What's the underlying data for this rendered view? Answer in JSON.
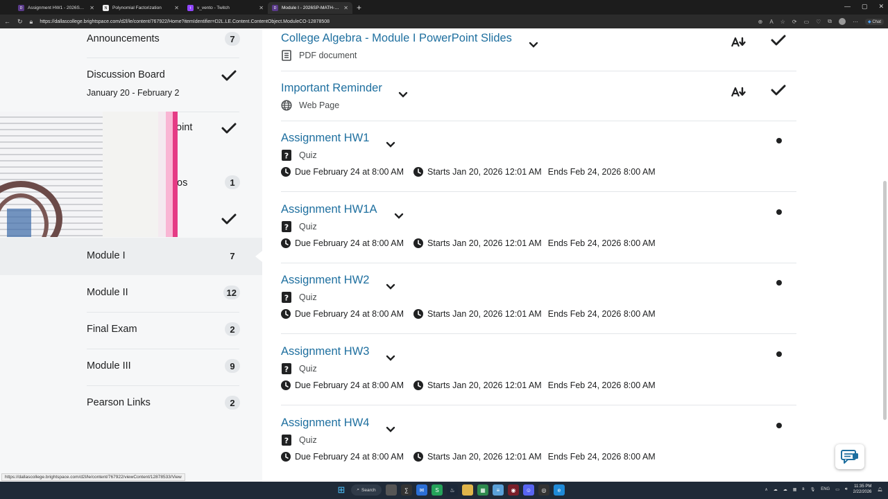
{
  "browser": {
    "tabs": [
      {
        "label": "Assignment HW1 - 2026SP-MATH-",
        "icon": "d2l-favicon",
        "color": "#5a3a8a",
        "active": false
      },
      {
        "label": "Polynomial Factorization",
        "icon": "notion-favicon",
        "color": "#444444",
        "active": false
      },
      {
        "label": "v_vento - Twitch",
        "icon": "twitch-favicon",
        "color": "#9146ff",
        "active": false
      },
      {
        "label": "Module I - 2026SP-MATH-1314-",
        "icon": "d2l-favicon",
        "color": "#5a3a8a",
        "active": true
      }
    ],
    "url": "https://dallascollege.brightspace.com/d2l/le/content/767922/Home?itemIdentifier=D2L.LE.Content.ContentObject.ModuleCO-12878508",
    "chat_label": "Chat",
    "status_url": "https://dallascollege.brightspace.com/d2l/le/content/767922/viewContent/12878533/View"
  },
  "sidebar": {
    "items": [
      {
        "label": "Announcements",
        "count": "7"
      },
      {
        "label": "Discussion Board",
        "sub": "January 20 - February 2",
        "done": true
      },
      {
        "label": "oint",
        "done": true
      },
      {
        "label": "os",
        "count": "1"
      },
      {
        "label": "",
        "done": true
      },
      {
        "label": "Module I",
        "count": "7",
        "active": true
      },
      {
        "label": "Module II",
        "count": "12"
      },
      {
        "label": "Final Exam",
        "count": "2"
      },
      {
        "label": "Module III",
        "count": "9"
      },
      {
        "label": "Pearson Links",
        "count": "2"
      }
    ]
  },
  "content": {
    "items": [
      {
        "title": "College Algebra - Module I PowerPoint Slides",
        "type": "PDF document",
        "type_icon": "document-icon"
      },
      {
        "title": "Important Reminder",
        "type": "Web Page",
        "type_icon": "globe-icon"
      },
      {
        "title": "Assignment HW1",
        "type": "Quiz",
        "due": "Due February 24 at 8:00 AM",
        "starts": "Starts Jan 20, 2026 12:01 AM",
        "ends": "Ends Feb 24, 2026 8:00 AM"
      },
      {
        "title": "Assignment HW1A",
        "type": "Quiz",
        "due": "Due February 24 at 8:00 AM",
        "starts": "Starts Jan 20, 2026 12:01 AM",
        "ends": "Ends Feb 24, 2026 8:00 AM"
      },
      {
        "title": "Assignment HW2",
        "type": "Quiz",
        "due": "Due February 24 at 8:00 AM",
        "starts": "Starts Jan 20, 2026 12:01 AM",
        "ends": "Ends Feb 24, 2026 8:00 AM"
      },
      {
        "title": "Assignment HW3",
        "type": "Quiz",
        "due": "Due February 24 at 8:00 AM",
        "starts": "Starts Jan 20, 2026 12:01 AM",
        "ends": "Ends Feb 24, 2026 8:00 AM"
      },
      {
        "title": "Assignment HW4",
        "type": "Quiz",
        "due": "Due February 24 at 8:00 AM",
        "starts": "Starts Jan 20, 2026 12:01 AM",
        "ends": "Ends Feb 24, 2026 8:00 AM"
      }
    ]
  },
  "taskbar": {
    "search_label": "Search",
    "lang": "ENG",
    "time": "11:35 PM",
    "date": "2/22/2026"
  },
  "colors": {
    "link": "#1e6f9f",
    "sidebar_bg": "#f6f7f8",
    "taskbar_bg": "#1f2a38"
  }
}
